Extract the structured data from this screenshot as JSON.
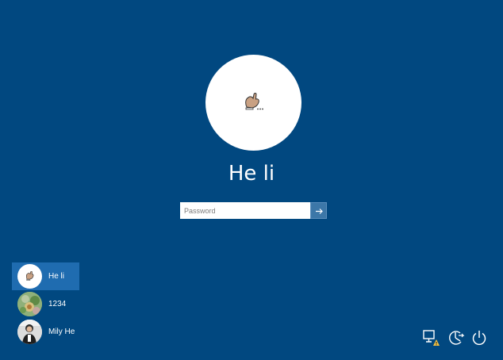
{
  "screen": {
    "background_color": "#014880",
    "selected_item_color": "#1f6cb0"
  },
  "main_user": {
    "name": "He li",
    "avatar_icon": "hand-sketch-avatar"
  },
  "password": {
    "placeholder": "Password",
    "value": "",
    "submit_icon": "arrow-right-icon"
  },
  "user_list": [
    {
      "label": "He li",
      "avatar_icon": "hand-sketch-avatar",
      "selected": true
    },
    {
      "label": "1234",
      "avatar_icon": "flower-photo-avatar",
      "selected": false
    },
    {
      "label": "Mily He",
      "avatar_icon": "person-photo-avatar",
      "selected": false
    }
  ],
  "system_icons": [
    {
      "name": "network-icon"
    },
    {
      "name": "ease-of-access-icon"
    },
    {
      "name": "power-icon"
    }
  ]
}
